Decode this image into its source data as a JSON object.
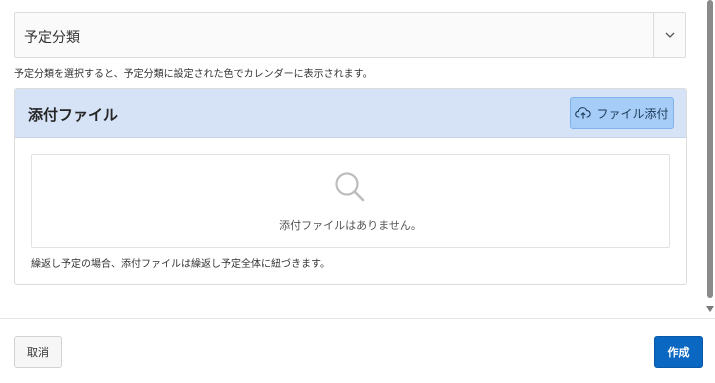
{
  "category": {
    "selected_value": "予定分類",
    "help_text": "予定分類を選択すると、予定分類に設定された色でカレンダーに表示されます。"
  },
  "attachments": {
    "title": "添付ファイル",
    "add_button_label": "ファイル添付",
    "empty_message": "添付ファイルはありません。",
    "note": "繰返し予定の場合、添付ファイルは繰返し予定全体に紐づきます。"
  },
  "footer": {
    "cancel_label": "取消",
    "create_label": "作成"
  },
  "colors": {
    "region_header_bg": "#d6e2f5",
    "attach_button_bg": "#a6cdf7",
    "primary_button_bg": "#0a67c2"
  },
  "icons": {
    "select_chevron": "chevron-down-icon",
    "attach": "cloud-upload-icon",
    "empty": "search-icon"
  }
}
